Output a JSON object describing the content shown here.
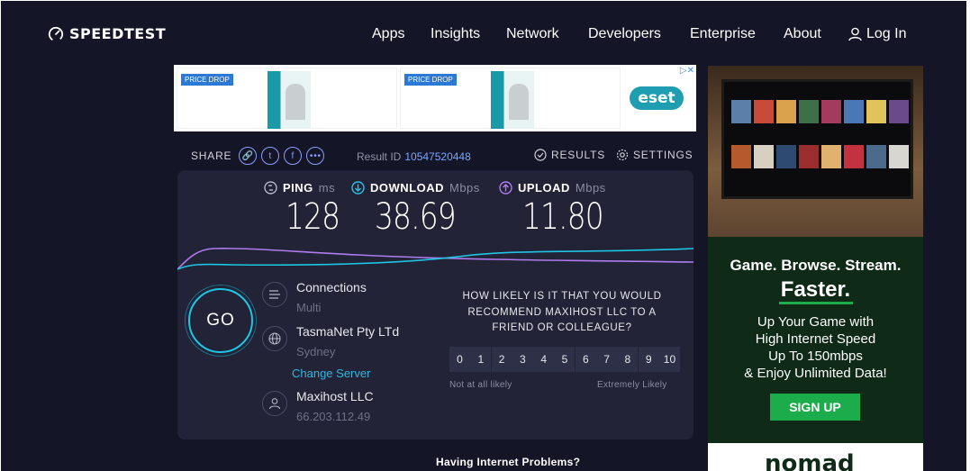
{
  "header": {
    "logo_text": "SPEEDTEST",
    "nav": [
      "Apps",
      "Insights",
      "Network",
      "Developers",
      "Enterprise",
      "About"
    ],
    "login": "Log In"
  },
  "ad_top": {
    "badge": "PRICE DROP",
    "brand": "eset"
  },
  "share": {
    "label": "SHARE",
    "result_label": "Result ID",
    "result_id": "10547520448",
    "results": "RESULTS",
    "settings": "SETTINGS"
  },
  "metrics": {
    "ping": {
      "label": "PING",
      "unit": "ms",
      "value": "128"
    },
    "download": {
      "label": "DOWNLOAD",
      "unit": "Mbps",
      "value": "38.69"
    },
    "upload": {
      "label": "UPLOAD",
      "unit": "Mbps",
      "value": "11.80"
    }
  },
  "go_label": "GO",
  "connections": {
    "title": "Connections",
    "sub": "Multi"
  },
  "isp": {
    "title": "TasmaNet Pty LTd",
    "sub": "Sydney",
    "change": "Change Server"
  },
  "host": {
    "title": "Maxihost LLC",
    "sub": "66.203.112.49"
  },
  "survey": {
    "question": "HOW LIKELY IS IT THAT YOU WOULD RECOMMEND MAXIHOST LLC TO A FRIEND OR COLLEAGUE?",
    "scale": [
      "0",
      "1",
      "2",
      "3",
      "4",
      "5",
      "6",
      "7",
      "8",
      "9",
      "10"
    ],
    "low": "Not at all likely",
    "high": "Extremely Likely"
  },
  "problems": "Having Internet Problems?",
  "ad_right": {
    "headline": "Game. Browse. Stream.",
    "faster": "Faster.",
    "line1": "Up Your Game with",
    "line2": "High Internet Speed",
    "line3": "Up To 150mbps",
    "line4": "& Enjoy Unlimited Data!",
    "cta": "SIGN UP",
    "brand": "nomad"
  },
  "colors": {
    "background": "#141526",
    "panel": "#222336",
    "accent_cyan": "#1fc5e5",
    "accent_purple": "#b07cf0",
    "link_blue": "#7aa6ff",
    "signup_green": "#1dac4c"
  }
}
